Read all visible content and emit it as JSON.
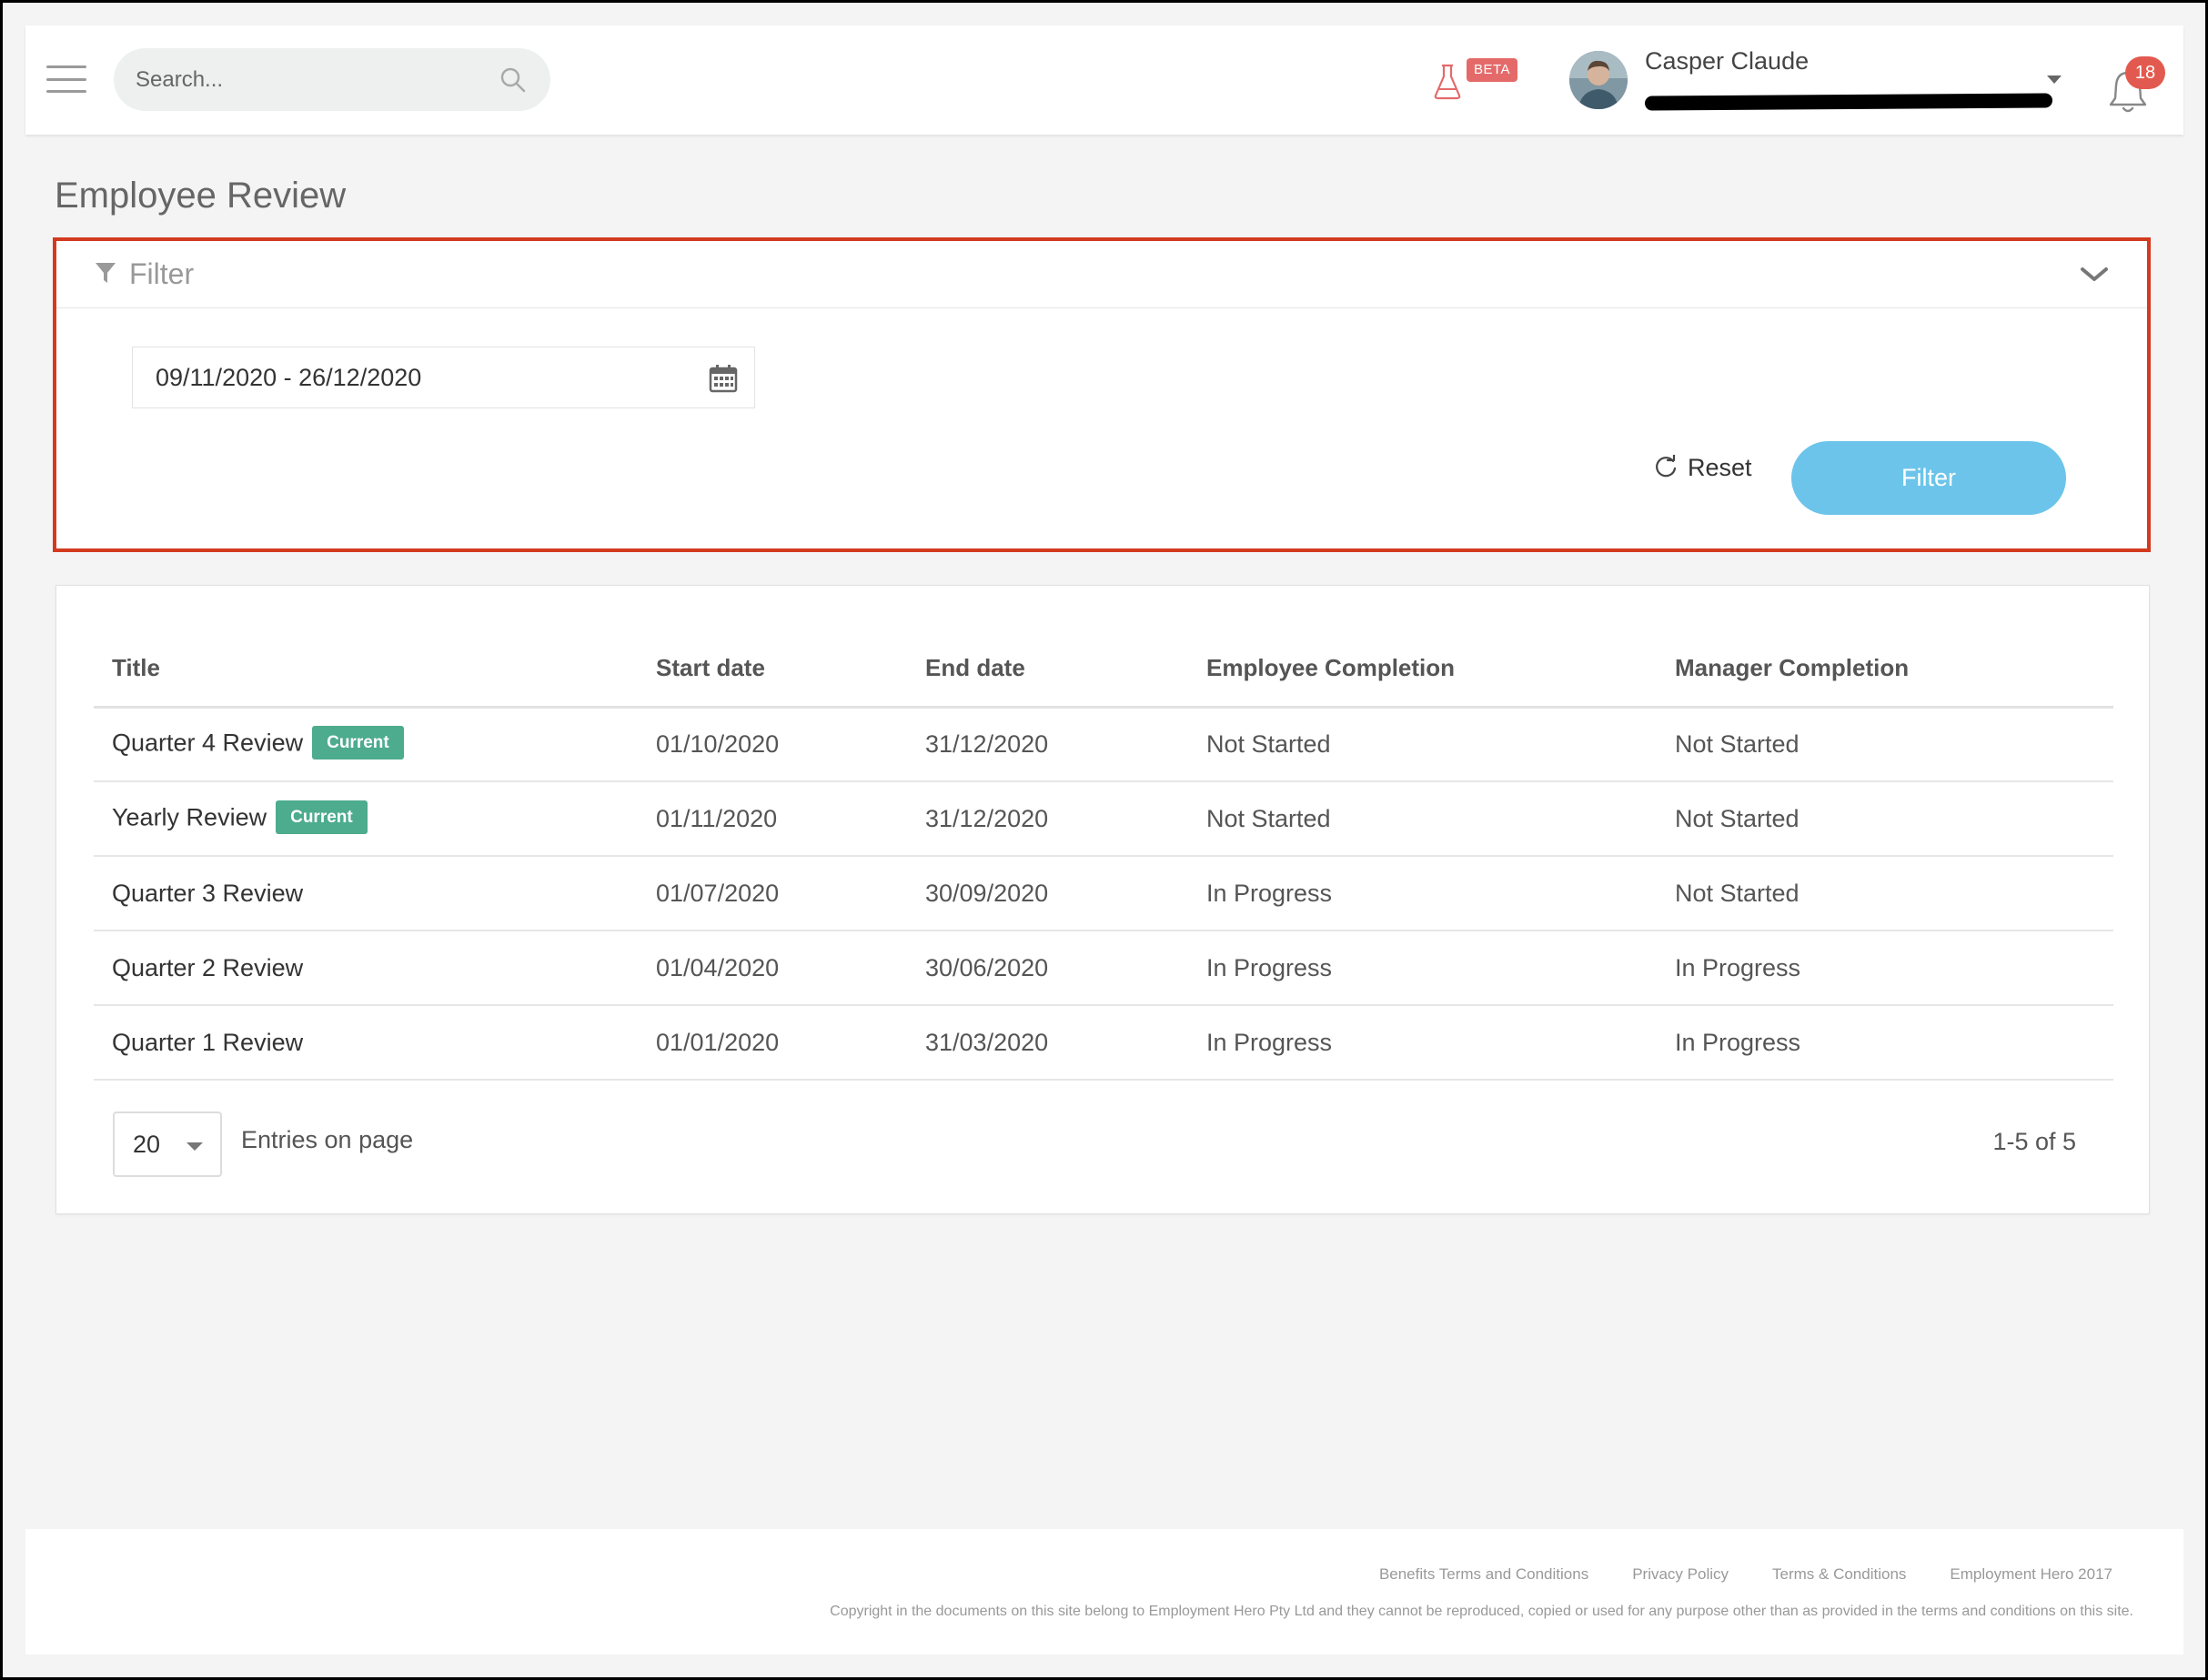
{
  "header": {
    "search_placeholder": "Search...",
    "beta_label": "BETA",
    "user_name": "Casper Claude",
    "notification_count": "18"
  },
  "page": {
    "title": "Employee Review"
  },
  "filter": {
    "title": "Filter",
    "date_range": "09/11/2020 - 26/12/2020",
    "reset_label": "Reset",
    "filter_button_label": "Filter"
  },
  "table": {
    "columns": [
      "Title",
      "Start date",
      "End date",
      "Employee Completion",
      "Manager Completion"
    ],
    "rows": [
      {
        "title": "Quarter 4 Review",
        "badge": "Current",
        "start": "01/10/2020",
        "end": "31/12/2020",
        "employee": "Not Started",
        "manager": "Not Started"
      },
      {
        "title": "Yearly Review",
        "badge": "Current",
        "start": "01/11/2020",
        "end": "31/12/2020",
        "employee": "Not Started",
        "manager": "Not Started"
      },
      {
        "title": "Quarter 3 Review",
        "badge": "",
        "start": "01/07/2020",
        "end": "30/09/2020",
        "employee": "In Progress",
        "manager": "Not Started"
      },
      {
        "title": "Quarter 2 Review",
        "badge": "",
        "start": "01/04/2020",
        "end": "30/06/2020",
        "employee": "In Progress",
        "manager": "In Progress"
      },
      {
        "title": "Quarter 1 Review",
        "badge": "",
        "start": "01/01/2020",
        "end": "31/03/2020",
        "employee": "In Progress",
        "manager": "In Progress"
      }
    ]
  },
  "pagination": {
    "entries_value": "20",
    "entries_label": "Entries on page",
    "range_info": "1-5 of 5"
  },
  "footer": {
    "links": [
      "Benefits Terms and Conditions",
      "Privacy Policy",
      "Terms & Conditions",
      "Employment Hero 2017"
    ],
    "copyright": "Copyright in the documents on this site belong to Employment Hero Pty Ltd and they cannot be reproduced, copied or used for any purpose other than as provided in the terms and conditions on this site."
  },
  "colors": {
    "accent_button": "#6cc4ea",
    "badge_current": "#4dab8e",
    "highlight_border": "#d33a1f",
    "notification_badge": "#e25a4f",
    "beta_badge": "#e46a6a"
  },
  "icons": [
    "hamburger-menu-icon",
    "search-icon",
    "flask-icon",
    "chevron-down-icon",
    "bell-icon",
    "filter-funnel-icon",
    "calendar-icon",
    "reset-refresh-icon"
  ]
}
